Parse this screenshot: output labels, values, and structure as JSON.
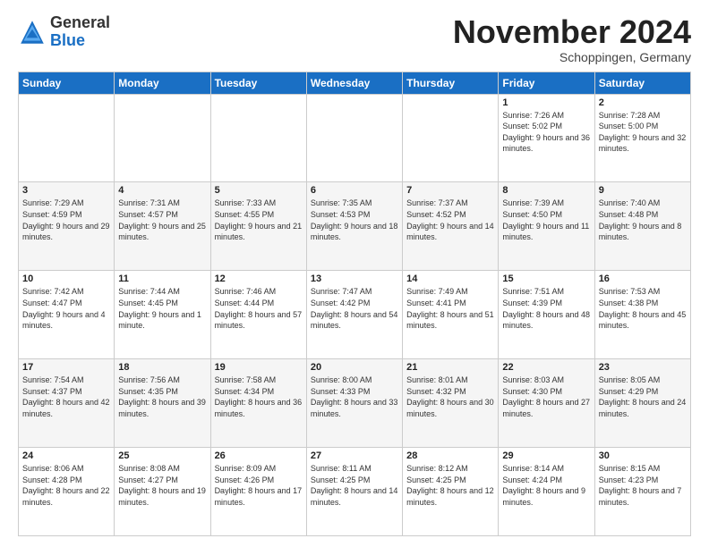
{
  "header": {
    "logo_general": "General",
    "logo_blue": "Blue",
    "month_title": "November 2024",
    "subtitle": "Schoppingen, Germany"
  },
  "days_of_week": [
    "Sunday",
    "Monday",
    "Tuesday",
    "Wednesday",
    "Thursday",
    "Friday",
    "Saturday"
  ],
  "weeks": [
    [
      {
        "day": "",
        "info": ""
      },
      {
        "day": "",
        "info": ""
      },
      {
        "day": "",
        "info": ""
      },
      {
        "day": "",
        "info": ""
      },
      {
        "day": "",
        "info": ""
      },
      {
        "day": "1",
        "info": "Sunrise: 7:26 AM\nSunset: 5:02 PM\nDaylight: 9 hours and 36 minutes."
      },
      {
        "day": "2",
        "info": "Sunrise: 7:28 AM\nSunset: 5:00 PM\nDaylight: 9 hours and 32 minutes."
      }
    ],
    [
      {
        "day": "3",
        "info": "Sunrise: 7:29 AM\nSunset: 4:59 PM\nDaylight: 9 hours and 29 minutes."
      },
      {
        "day": "4",
        "info": "Sunrise: 7:31 AM\nSunset: 4:57 PM\nDaylight: 9 hours and 25 minutes."
      },
      {
        "day": "5",
        "info": "Sunrise: 7:33 AM\nSunset: 4:55 PM\nDaylight: 9 hours and 21 minutes."
      },
      {
        "day": "6",
        "info": "Sunrise: 7:35 AM\nSunset: 4:53 PM\nDaylight: 9 hours and 18 minutes."
      },
      {
        "day": "7",
        "info": "Sunrise: 7:37 AM\nSunset: 4:52 PM\nDaylight: 9 hours and 14 minutes."
      },
      {
        "day": "8",
        "info": "Sunrise: 7:39 AM\nSunset: 4:50 PM\nDaylight: 9 hours and 11 minutes."
      },
      {
        "day": "9",
        "info": "Sunrise: 7:40 AM\nSunset: 4:48 PM\nDaylight: 9 hours and 8 minutes."
      }
    ],
    [
      {
        "day": "10",
        "info": "Sunrise: 7:42 AM\nSunset: 4:47 PM\nDaylight: 9 hours and 4 minutes."
      },
      {
        "day": "11",
        "info": "Sunrise: 7:44 AM\nSunset: 4:45 PM\nDaylight: 9 hours and 1 minute."
      },
      {
        "day": "12",
        "info": "Sunrise: 7:46 AM\nSunset: 4:44 PM\nDaylight: 8 hours and 57 minutes."
      },
      {
        "day": "13",
        "info": "Sunrise: 7:47 AM\nSunset: 4:42 PM\nDaylight: 8 hours and 54 minutes."
      },
      {
        "day": "14",
        "info": "Sunrise: 7:49 AM\nSunset: 4:41 PM\nDaylight: 8 hours and 51 minutes."
      },
      {
        "day": "15",
        "info": "Sunrise: 7:51 AM\nSunset: 4:39 PM\nDaylight: 8 hours and 48 minutes."
      },
      {
        "day": "16",
        "info": "Sunrise: 7:53 AM\nSunset: 4:38 PM\nDaylight: 8 hours and 45 minutes."
      }
    ],
    [
      {
        "day": "17",
        "info": "Sunrise: 7:54 AM\nSunset: 4:37 PM\nDaylight: 8 hours and 42 minutes."
      },
      {
        "day": "18",
        "info": "Sunrise: 7:56 AM\nSunset: 4:35 PM\nDaylight: 8 hours and 39 minutes."
      },
      {
        "day": "19",
        "info": "Sunrise: 7:58 AM\nSunset: 4:34 PM\nDaylight: 8 hours and 36 minutes."
      },
      {
        "day": "20",
        "info": "Sunrise: 8:00 AM\nSunset: 4:33 PM\nDaylight: 8 hours and 33 minutes."
      },
      {
        "day": "21",
        "info": "Sunrise: 8:01 AM\nSunset: 4:32 PM\nDaylight: 8 hours and 30 minutes."
      },
      {
        "day": "22",
        "info": "Sunrise: 8:03 AM\nSunset: 4:30 PM\nDaylight: 8 hours and 27 minutes."
      },
      {
        "day": "23",
        "info": "Sunrise: 8:05 AM\nSunset: 4:29 PM\nDaylight: 8 hours and 24 minutes."
      }
    ],
    [
      {
        "day": "24",
        "info": "Sunrise: 8:06 AM\nSunset: 4:28 PM\nDaylight: 8 hours and 22 minutes."
      },
      {
        "day": "25",
        "info": "Sunrise: 8:08 AM\nSunset: 4:27 PM\nDaylight: 8 hours and 19 minutes."
      },
      {
        "day": "26",
        "info": "Sunrise: 8:09 AM\nSunset: 4:26 PM\nDaylight: 8 hours and 17 minutes."
      },
      {
        "day": "27",
        "info": "Sunrise: 8:11 AM\nSunset: 4:25 PM\nDaylight: 8 hours and 14 minutes."
      },
      {
        "day": "28",
        "info": "Sunrise: 8:12 AM\nSunset: 4:25 PM\nDaylight: 8 hours and 12 minutes."
      },
      {
        "day": "29",
        "info": "Sunrise: 8:14 AM\nSunset: 4:24 PM\nDaylight: 8 hours and 9 minutes."
      },
      {
        "day": "30",
        "info": "Sunrise: 8:15 AM\nSunset: 4:23 PM\nDaylight: 8 hours and 7 minutes."
      }
    ]
  ]
}
